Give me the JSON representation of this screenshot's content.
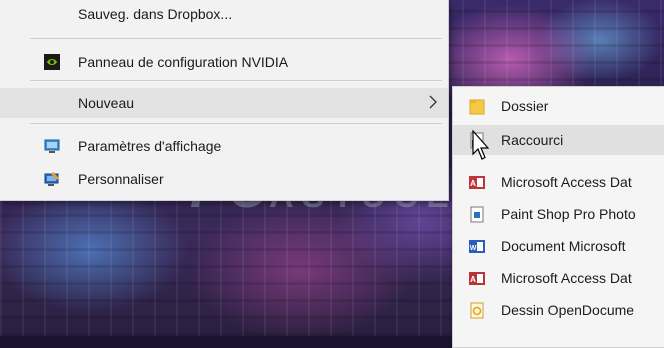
{
  "context_menu": {
    "items": [
      {
        "label": "Sauveg. dans Dropbox...",
        "icon": "dropbox-icon"
      },
      {
        "label": "Panneau de configuration NVIDIA",
        "icon": "nvidia-icon"
      },
      {
        "label": "Nouveau",
        "icon": "",
        "has_submenu": true
      },
      {
        "label": "Paramètres d'affichage",
        "icon": "display-settings-icon"
      },
      {
        "label": "Personnaliser",
        "icon": "personalize-icon"
      }
    ]
  },
  "submenu_new": {
    "items": [
      {
        "label": "Dossier",
        "icon": "folder-icon"
      },
      {
        "label": "Raccourci",
        "icon": "shortcut-icon"
      },
      {
        "label": "Microsoft Access Dat",
        "icon": "access-icon"
      },
      {
        "label": "Paint Shop Pro Photo",
        "icon": "psp-icon"
      },
      {
        "label": "Document Microsoft",
        "icon": "word-icon"
      },
      {
        "label": "Microsoft Access Dat",
        "icon": "access-db-icon"
      },
      {
        "label": "Dessin OpenDocume",
        "icon": "odg-icon"
      }
    ]
  },
  "watermark": {
    "text": "PC",
    "text2": "ASTUCES"
  },
  "colors": {
    "menu_bg": "#f2f2f2",
    "hover": "#e3e3e3",
    "nvidia_green": "#76b900"
  }
}
